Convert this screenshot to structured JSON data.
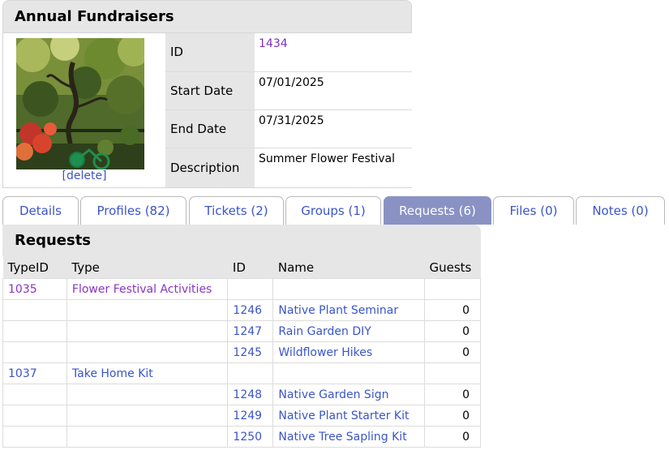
{
  "header": {
    "title": "Annual Fundraisers",
    "delete_label": "[delete]",
    "fields": [
      {
        "label": "ID",
        "value": "1434"
      },
      {
        "label": "Start Date",
        "value": "07/01/2025"
      },
      {
        "label": "End Date",
        "value": "07/31/2025"
      },
      {
        "label": "Description",
        "value": "Summer Flower Festival"
      }
    ]
  },
  "tabs": [
    {
      "label": "Details"
    },
    {
      "label": "Profiles (82)"
    },
    {
      "label": "Tickets (2)"
    },
    {
      "label": "Groups (1)"
    },
    {
      "label": "Requests (6)"
    },
    {
      "label": "Files (0)"
    },
    {
      "label": "Notes (0)"
    }
  ],
  "active_tab": "Requests (6)",
  "requests": {
    "title": "Requests",
    "columns": [
      "TypeID",
      "Type",
      "ID",
      "Name",
      "Guests"
    ],
    "rows": [
      {
        "typeid": "1035",
        "type": "Flower Festival Activities",
        "id": "",
        "name": "",
        "guests": ""
      },
      {
        "typeid": "",
        "type": "",
        "id": "1246",
        "name": "Native Plant Seminar",
        "guests": "0"
      },
      {
        "typeid": "",
        "type": "",
        "id": "1247",
        "name": "Rain Garden DIY",
        "guests": "0"
      },
      {
        "typeid": "",
        "type": "",
        "id": "1245",
        "name": "Wildflower Hikes",
        "guests": "0"
      },
      {
        "typeid": "1037",
        "type": "Take Home Kit",
        "id": "",
        "name": "",
        "guests": ""
      },
      {
        "typeid": "",
        "type": "",
        "id": "1248",
        "name": "Native Garden Sign",
        "guests": "0"
      },
      {
        "typeid": "",
        "type": "",
        "id": "1249",
        "name": "Native Plant Starter Kit",
        "guests": "0"
      },
      {
        "typeid": "",
        "type": "",
        "id": "1250",
        "name": "Native Tree Sapling Kit",
        "guests": "0"
      }
    ]
  },
  "colors": {
    "link": "#3a55c9",
    "visited_link": "#8a35c0",
    "active_tab": "#8a92c4",
    "header_bg": "#e6e6e6"
  }
}
